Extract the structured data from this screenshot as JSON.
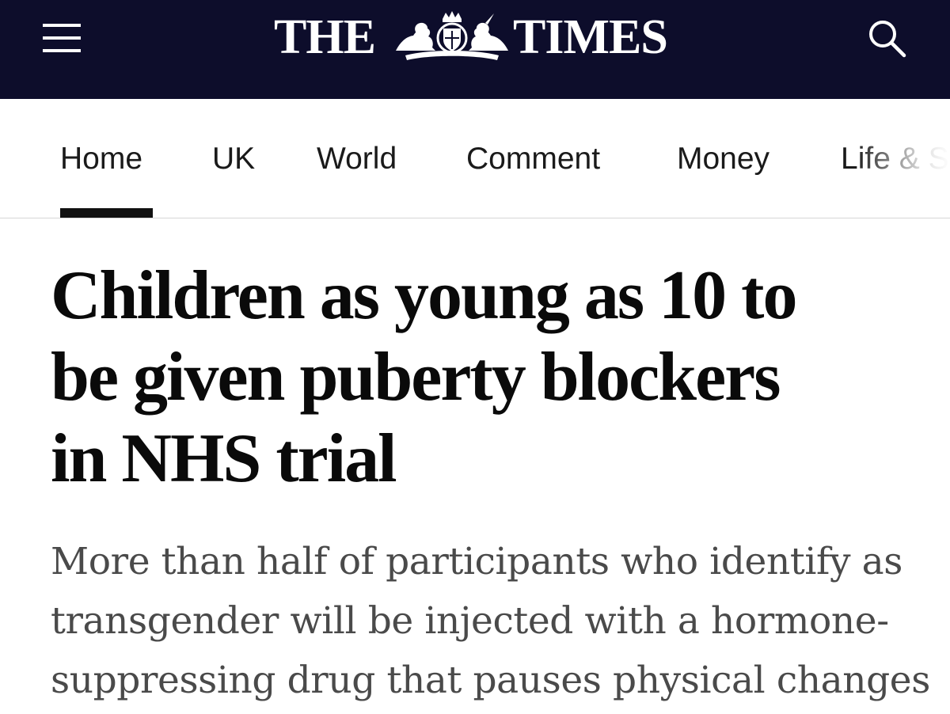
{
  "masthead": {
    "logo_left": "THE",
    "logo_right": "TIMES",
    "crest_motto_left": "PDIEU ET",
    "crest_motto_right": "MON DROIT",
    "menu_icon": "hamburger-menu-icon",
    "search_icon": "search-icon",
    "background_color": "#0d0d2b"
  },
  "nav": {
    "items": [
      {
        "label": "Home",
        "active": true
      },
      {
        "label": "UK",
        "active": false
      },
      {
        "label": "World",
        "active": false
      },
      {
        "label": "Comment",
        "active": false
      },
      {
        "label": "Money",
        "active": false
      },
      {
        "label": "Life & S",
        "active": false
      }
    ]
  },
  "article": {
    "headline_lines": [
      "Children as young as 10 to",
      "be given puberty blockers",
      "in NHS trial"
    ],
    "standfirst_lines": [
      "More than half of participants who identify as",
      "transgender will be injected with a hormone-",
      "suppressing drug that pauses physical changes"
    ]
  }
}
